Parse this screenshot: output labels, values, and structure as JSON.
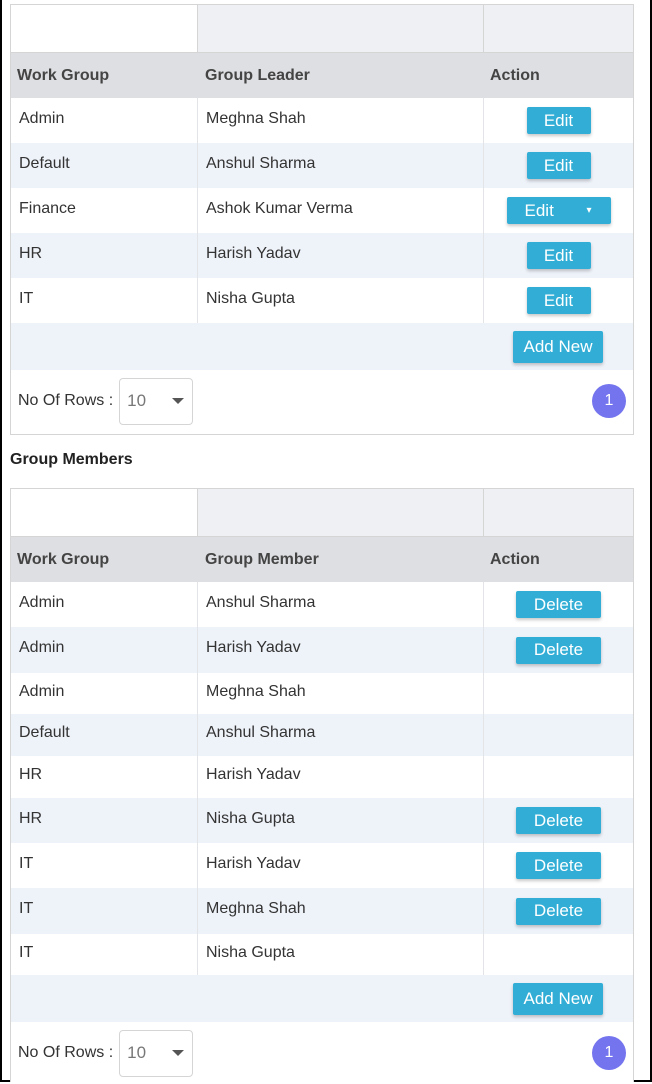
{
  "leaders_table": {
    "headers": {
      "work_group": "Work Group",
      "group_leader": "Group Leader",
      "action": "Action"
    },
    "rows": [
      {
        "work_group": "Admin",
        "leader": "Meghna Shah",
        "action": "Edit"
      },
      {
        "work_group": "Default",
        "leader": "Anshul Sharma",
        "action": "Edit"
      },
      {
        "work_group": "Finance",
        "leader": "Ashok Kumar Verma",
        "action": "Edit",
        "has_dropdown": true
      },
      {
        "work_group": "HR",
        "leader": "Harish Yadav",
        "action": "Edit"
      },
      {
        "work_group": "IT",
        "leader": "Nisha Gupta",
        "action": "Edit"
      }
    ],
    "add_new_label": "Add New",
    "rows_label": "No Of Rows :",
    "rows_value": "10",
    "page": "1"
  },
  "members_title": "Group Members",
  "members_table": {
    "headers": {
      "work_group": "Work Group",
      "group_member": "Group Member",
      "action": "Action"
    },
    "rows": [
      {
        "work_group": "Admin",
        "member": "Anshul Sharma",
        "action": "Delete"
      },
      {
        "work_group": "Admin",
        "member": "Harish Yadav",
        "action": "Delete"
      },
      {
        "work_group": "Admin",
        "member": "Meghna Shah",
        "action": ""
      },
      {
        "work_group": "Default",
        "member": "Anshul Sharma",
        "action": ""
      },
      {
        "work_group": "HR",
        "member": "Harish Yadav",
        "action": ""
      },
      {
        "work_group": "HR",
        "member": "Nisha Gupta",
        "action": "Delete"
      },
      {
        "work_group": "IT",
        "member": "Harish Yadav",
        "action": "Delete"
      },
      {
        "work_group": "IT",
        "member": "Meghna Shah",
        "action": "Delete"
      },
      {
        "work_group": "IT",
        "member": "Nisha Gupta",
        "action": ""
      }
    ],
    "add_new_label": "Add New",
    "rows_label": "No Of Rows :",
    "rows_value": "10",
    "page": "1"
  },
  "colors": {
    "button": "#32aed6",
    "header_bg": "#dedfe2",
    "alt_row": "#eef2f9",
    "page_badge": "#7474ee"
  }
}
